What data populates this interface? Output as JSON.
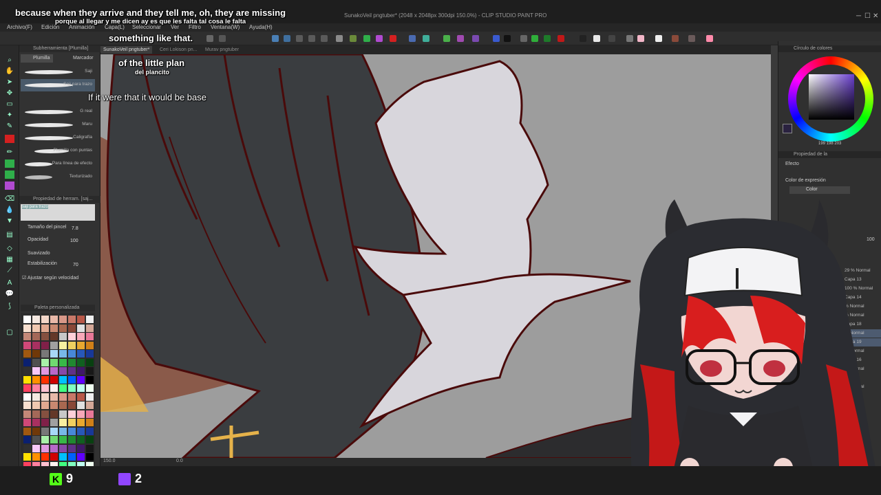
{
  "window": {
    "title": "SunakoVeil pngtuber* (2048 x 2048px 300dpi 150.0%) - CLIP STUDIO PAINT PRO"
  },
  "menu": [
    "Archivo(F)",
    "Edición",
    "Animación",
    "Capa(L)",
    "Seleccionar",
    "Ver",
    "Filtro",
    "Ventana(W)",
    "Ayuda(H)"
  ],
  "tabs": [
    "SunakoVeil pngtuber*",
    "Ceri Lokison pn...",
    "Murav pngtuber"
  ],
  "left_panel": {
    "subtool_header": "Subherramienta [Plumilla]",
    "tab_pen": "Plumilla",
    "tab_marker": "Marcador",
    "brushes": [
      "Saji",
      "Saji para trazo",
      "G real",
      "Maru",
      "Caligrafía",
      "Plumilla con puntas",
      "Para línea de efecto",
      "Texturizado"
    ],
    "tool_property_header": "Propiedad de herram. [saj...",
    "brush_preview_label": "saji para trazo",
    "props": {
      "brush_size_label": "Tamaño del pincel",
      "brush_size_value": "7.8",
      "opacity_label": "Opacidad",
      "opacity_value": "100",
      "smoothing_label": "Suavizado",
      "stabilization_label": "Estabilización",
      "stabilization_value": "70",
      "speed_label": "Ajustar según velocidad"
    },
    "palette_header": "Paleta personalizada"
  },
  "right_panel": {
    "color_wheel_header": "Círculo de colores",
    "rgb_values": [
      "199",
      "198",
      "203"
    ],
    "layer_property_header": "Propiedad de la",
    "effect_label": "Efecto",
    "expression_color_label": "Color de expresión",
    "expression_color_value": "Color",
    "opacity_value": "100",
    "layers": [
      {
        "label": "29 % Normal",
        "selected": false
      },
      {
        "label": "Capa 13",
        "selected": false
      },
      {
        "label": "100 % Normal",
        "selected": false
      },
      {
        "label": "Capa 14",
        "selected": false
      },
      {
        "label": "% Normal",
        "selected": false
      },
      {
        "label": "% Normal",
        "selected": false
      },
      {
        "label": "Capa 18",
        "selected": false
      },
      {
        "label": "% Normal",
        "selected": true
      },
      {
        "label": "Capa 19",
        "selected": true
      },
      {
        "label": "% Normal",
        "selected": false
      },
      {
        "label": "Capa 16",
        "selected": false
      },
      {
        "label": "% Normal",
        "selected": false
      },
      {
        "label": "Normal",
        "selected": false
      },
      {
        "label": "% Normal",
        "selected": false
      }
    ]
  },
  "status": {
    "zoom": "150.0",
    "angle": "0.0"
  },
  "subtitles": {
    "line1_en": "because when they arrive and they tell me, oh, they are missing",
    "line1_es": "porque al llegar y me dicen ay es que les falta tal cosa le falta",
    "line2_en": "something like that.",
    "line3_en": "of the little plan",
    "line3_es": "del plancito",
    "line4_en": "If it were that it would be base"
  },
  "overlay_stats": {
    "kick_count": "9",
    "twitch_count": "2"
  },
  "colors": {
    "accent_red": "#d42020",
    "kick_green": "#53fc18",
    "twitch_purple": "#9146ff",
    "lineart": "#5a0a0a"
  }
}
